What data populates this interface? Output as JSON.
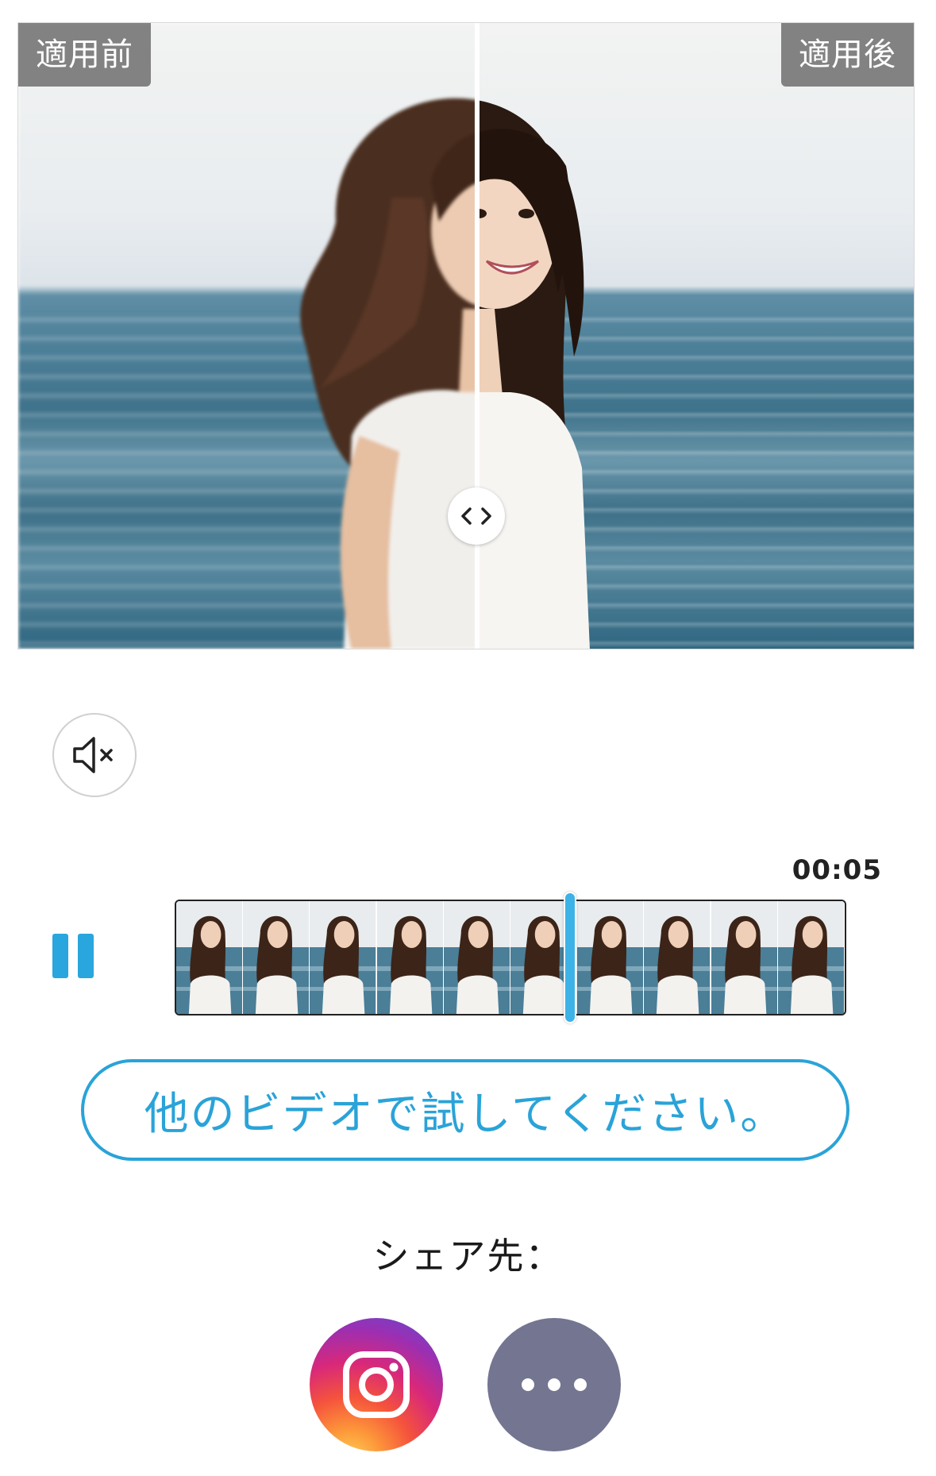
{
  "viewer": {
    "before_label": "適用前",
    "after_label": "適用後",
    "divider_position": 0.51,
    "handle_icon": "chevrons-left-right-icon"
  },
  "controls": {
    "mute_icon": "speaker-muted-icon",
    "pause_icon": "pause-icon",
    "current_time": "00:05",
    "playhead_position": 0.59,
    "filmstrip_frame_count": 10
  },
  "actions": {
    "try_other_video": "他のビデオで試してください。"
  },
  "share": {
    "label": "シェア先：",
    "targets": [
      {
        "name": "instagram",
        "icon": "instagram-icon"
      },
      {
        "name": "more",
        "icon": "more-dots-icon"
      }
    ]
  },
  "colors": {
    "accent": "#2aa3d8",
    "tag_bg": "#787878",
    "more_bg": "#737591"
  }
}
